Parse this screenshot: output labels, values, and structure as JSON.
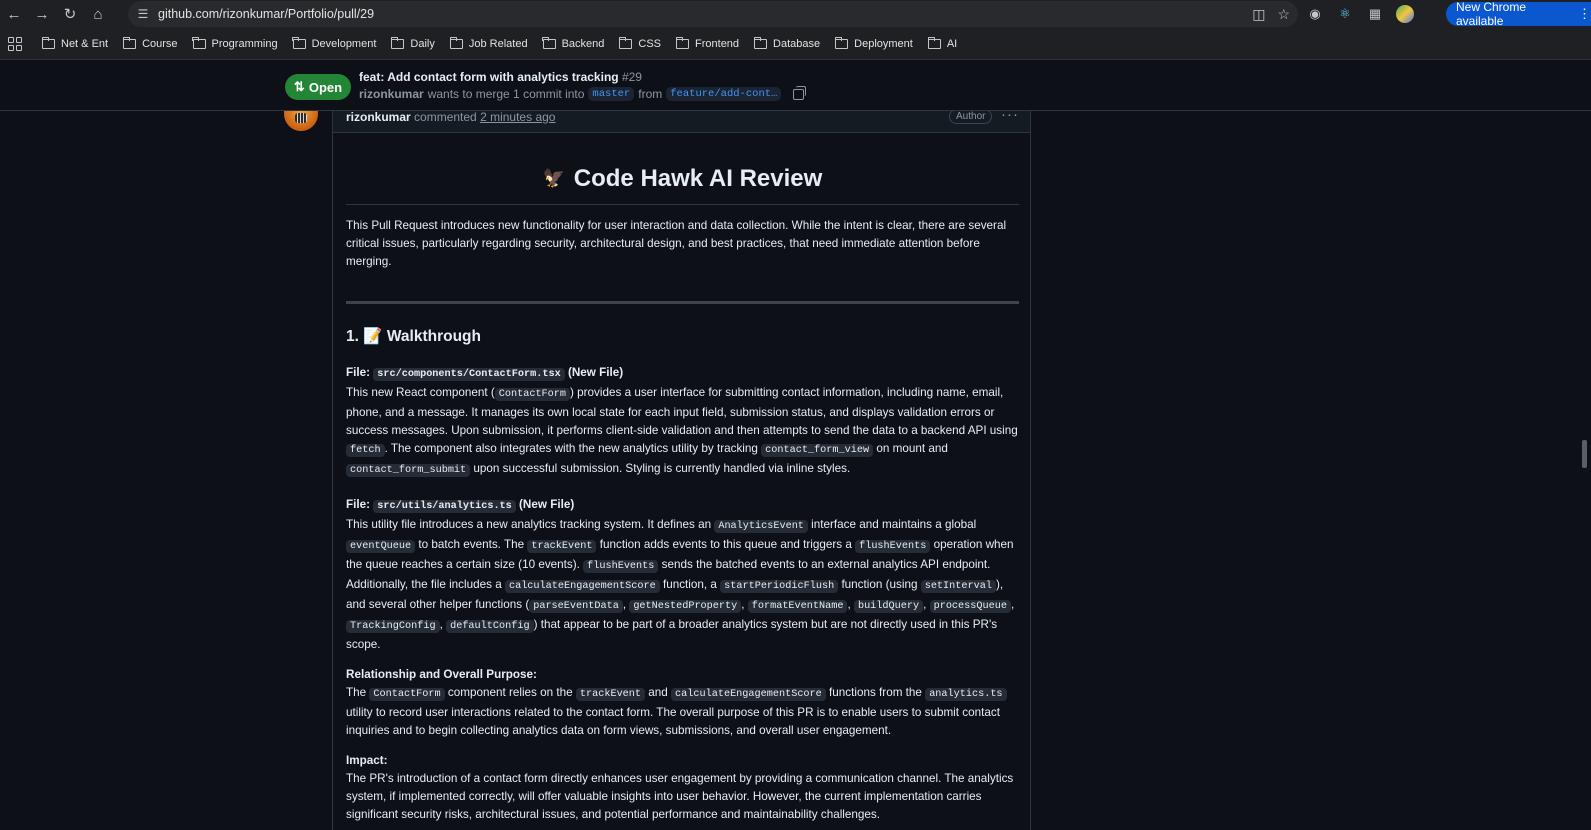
{
  "browser": {
    "url": "github.com/rizonkumar/Portfolio/pull/29",
    "update_label": "New Chrome available",
    "bookmarks": [
      "Net & Ent",
      "Course",
      "Programming",
      "Development",
      "Daily",
      "Job Related",
      "Backend",
      "CSS",
      "Frontend",
      "Database",
      "Deployment",
      "AI"
    ]
  },
  "pr": {
    "state": "Open",
    "title": "feat: Add contact form with analytics tracking",
    "number": "#29",
    "author": "rizonkumar",
    "merge_text_1": "wants to merge 1 commit into",
    "base_branch": "master",
    "merge_text_2": "from",
    "head_branch": "feature/add-cont…"
  },
  "comment": {
    "author": "rizonkumar",
    "action": "commented",
    "time": "2 minutes ago",
    "badge": "Author",
    "title_emoji": "🦅",
    "title": "Code Hawk AI Review",
    "intro": "This Pull Request introduces new functionality for user interaction and data collection. While the intent is clear, there are several critical issues, particularly regarding security, architectural design, and best practices, that need immediate attention before merging.",
    "walkthrough_heading": "1. 📝 Walkthrough",
    "file1": {
      "label": "File:",
      "path": "src/components/ContactForm.tsx",
      "tag": "(New File)",
      "t1": "This new React component (",
      "c1": "ContactForm",
      "t2": ") provides a user interface for submitting contact information, including name, email, phone, and a message. It manages its own local state for each input field, submission status, and displays validation errors or success messages. Upon submission, it performs client-side validation and then attempts to send the data to a backend API using",
      "c2": "fetch",
      "t3": ". The component also integrates with the new analytics utility by tracking",
      "c3": "contact_form_view",
      "t4": "on mount and",
      "c4": "contact_form_submit",
      "t5": "upon successful submission. Styling is currently handled via inline styles."
    },
    "file2": {
      "label": "File:",
      "path": "src/utils/analytics.ts",
      "tag": "(New File)",
      "t1": "This utility file introduces a new analytics tracking system. It defines an",
      "c1": "AnalyticsEvent",
      "t2": "interface and maintains a global",
      "c2": "eventQueue",
      "t3": "to batch events. The",
      "c3": "trackEvent",
      "t4": "function adds events to this queue and triggers a",
      "c4": "flushEvents",
      "t5": "operation when the queue reaches a certain size (10 events).",
      "c5": "flushEvents",
      "t6": "sends the batched events to an external analytics API endpoint. Additionally, the file includes a",
      "c6": "calculateEngagementScore",
      "t7": "function, a",
      "c7": "startPeriodicFlush",
      "t8": "function (using",
      "c8": "setInterval",
      "t9": "), and several other helper functions (",
      "c9": "parseEventData",
      "c10": "getNestedProperty",
      "c11": "formatEventName",
      "c12": "buildQuery",
      "c13": "processQueue",
      "c14": "TrackingConfig",
      "c15": "defaultConfig",
      "t10": ") that appear to be part of a broader analytics system but are not directly used in this PR's scope."
    },
    "relationship": {
      "heading": "Relationship and Overall Purpose:",
      "t1": "The",
      "c1": "ContactForm",
      "t2": "component relies on the",
      "c2": "trackEvent",
      "t3": "and",
      "c3": "calculateEngagementScore",
      "t4": "functions from the",
      "c4": "analytics.ts",
      "t5": "utility to record user interactions related to the contact form. The overall purpose of this PR is to enable users to submit contact inquiries and to begin collecting analytics data on form views, submissions, and overall user engagement."
    },
    "impact": {
      "heading": "Impact:",
      "text": "The PR's introduction of a contact form directly enhances user engagement by providing a communication channel. The analytics system, if implemented correctly, will offer valuable insights into user behavior. However, the current implementation carries significant security risks, architectural issues, and potential performance and maintainability challenges."
    }
  }
}
